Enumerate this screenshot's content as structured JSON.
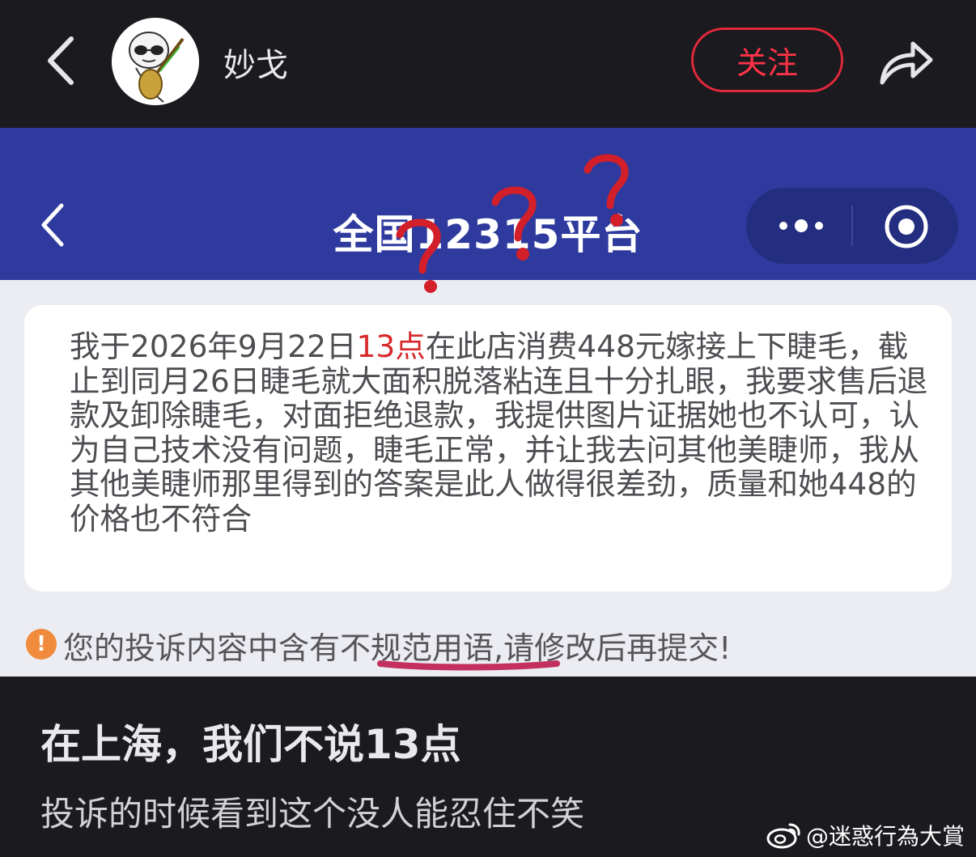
{
  "topbar": {
    "username": "妙戈",
    "follow_label": "关注",
    "icons": [
      "back-arrow-icon",
      "avatar",
      "share-icon"
    ]
  },
  "screenshot": {
    "title": "全国12315平台",
    "complaint_text_before": "我于2026年9月22日",
    "complaint_text_highlight": "13点",
    "complaint_text_after": "在此店消费448元嫁接上下睫毛，截止到同月26日睫毛就大面积脱落粘连且十分扎眼，我要求售后退款及卸除睫毛，对面拒绝退款，我提供图片证据她也不认可，认为自己技术没有问题，睫毛正常，并让我去问其他美睫师，我从其他美睫师那里得到的答案是此人做得很差劲，质量和她448的价格也不符合",
    "warning_text": "您的投诉内容中含有不规范用语,请修改后再提交!",
    "icons": [
      "back-arrow-icon",
      "more-dots-icon",
      "target-icon",
      "warning-icon"
    ]
  },
  "post": {
    "title": "在上海，我们不说13点",
    "body": "投诉的时候看到这个没人能忍住不笑"
  },
  "watermark": "@迷惑行為大賞",
  "colors": {
    "background": "#1b1a1f",
    "follow_red": "#ff3347",
    "header_blue": "#2e3a9e",
    "highlight_red": "#d7282a",
    "warning_orange": "#f08a3c"
  }
}
